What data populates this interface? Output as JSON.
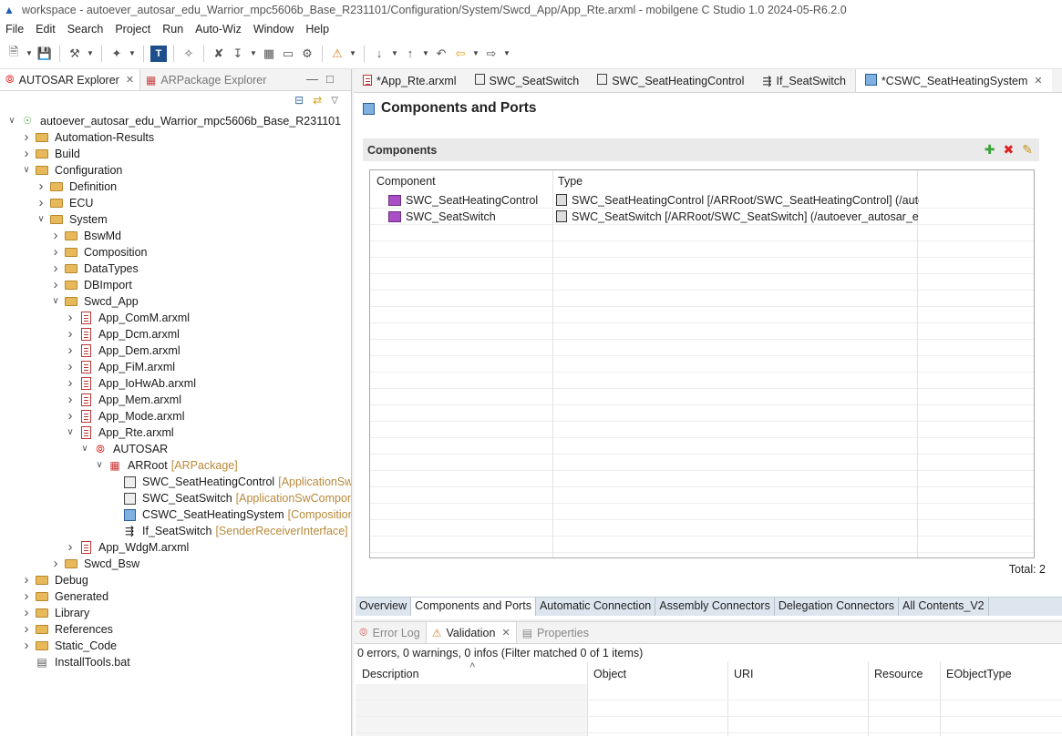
{
  "window": {
    "title": "workspace - autoever_autosar_edu_Warrior_mpc5606b_Base_R231101/Configuration/System/Swcd_App/App_Rte.arxml - mobilgene C Studio 1.0 2024-05-R6.2.0"
  },
  "menu": [
    "File",
    "Edit",
    "Search",
    "Project",
    "Run",
    "Auto-Wiz",
    "Window",
    "Help"
  ],
  "left_tabs": {
    "explorer": "AUTOSAR Explorer",
    "package_explorer": "ARPackage Explorer"
  },
  "tree": [
    {
      "label": "autoever_autosar_edu_Warrior_mpc5606b_Base_R231101",
      "type": "",
      "icon": "project-icon",
      "indent": 0,
      "arrow": "down"
    },
    {
      "label": "Automation-Results",
      "type": "",
      "icon": "folder-icon",
      "indent": 1,
      "arrow": "right"
    },
    {
      "label": "Build",
      "type": "",
      "icon": "folder-icon",
      "indent": 1,
      "arrow": "right"
    },
    {
      "label": "Configuration",
      "type": "",
      "icon": "folder-icon",
      "indent": 1,
      "arrow": "down"
    },
    {
      "label": "Definition",
      "type": "",
      "icon": "folder-icon",
      "indent": 2,
      "arrow": "right"
    },
    {
      "label": "ECU",
      "type": "",
      "icon": "folder-icon",
      "indent": 2,
      "arrow": "right"
    },
    {
      "label": "System",
      "type": "",
      "icon": "folder-icon",
      "indent": 2,
      "arrow": "down"
    },
    {
      "label": "BswMd",
      "type": "",
      "icon": "folder-icon",
      "indent": 3,
      "arrow": "right"
    },
    {
      "label": "Composition",
      "type": "",
      "icon": "folder-icon",
      "indent": 3,
      "arrow": "right"
    },
    {
      "label": "DataTypes",
      "type": "",
      "icon": "folder-icon",
      "indent": 3,
      "arrow": "right"
    },
    {
      "label": "DBImport",
      "type": "",
      "icon": "folder-icon",
      "indent": 3,
      "arrow": "right"
    },
    {
      "label": "Swcd_App",
      "type": "",
      "icon": "folder-icon",
      "indent": 3,
      "arrow": "down"
    },
    {
      "label": "App_ComM.arxml",
      "type": "",
      "icon": "arxml-file-icon",
      "indent": 4,
      "arrow": "right"
    },
    {
      "label": "App_Dcm.arxml",
      "type": "",
      "icon": "arxml-file-icon",
      "indent": 4,
      "arrow": "right"
    },
    {
      "label": "App_Dem.arxml",
      "type": "",
      "icon": "arxml-file-icon",
      "indent": 4,
      "arrow": "right"
    },
    {
      "label": "App_FiM.arxml",
      "type": "",
      "icon": "arxml-file-icon",
      "indent": 4,
      "arrow": "right"
    },
    {
      "label": "App_IoHwAb.arxml",
      "type": "",
      "icon": "arxml-file-icon",
      "indent": 4,
      "arrow": "right"
    },
    {
      "label": "App_Mem.arxml",
      "type": "",
      "icon": "arxml-file-icon",
      "indent": 4,
      "arrow": "right"
    },
    {
      "label": "App_Mode.arxml",
      "type": "",
      "icon": "arxml-file-icon",
      "indent": 4,
      "arrow": "right"
    },
    {
      "label": "App_Rte.arxml",
      "type": "",
      "icon": "arxml-file-icon",
      "indent": 4,
      "arrow": "down"
    },
    {
      "label": "AUTOSAR",
      "type": "",
      "icon": "autosar-icon",
      "indent": 5,
      "arrow": "down"
    },
    {
      "label": "ARRoot",
      "type": "[ARPackage]",
      "icon": "package-icon",
      "indent": 6,
      "arrow": "down"
    },
    {
      "label": "SWC_SeatHeatingControl",
      "type": "[ApplicationSwComponentType]",
      "icon": "swc-icon",
      "indent": 7,
      "arrow": ""
    },
    {
      "label": "SWC_SeatSwitch",
      "type": "[ApplicationSwComponentType]",
      "icon": "swc-icon",
      "indent": 7,
      "arrow": ""
    },
    {
      "label": "CSWC_SeatHeatingSystem",
      "type": "[CompositionSwComponentType]",
      "icon": "composition-icon",
      "indent": 7,
      "arrow": ""
    },
    {
      "label": "If_SeatSwitch",
      "type": "[SenderReceiverInterface]",
      "icon": "interface-icon",
      "indent": 7,
      "arrow": ""
    },
    {
      "label": "App_WdgM.arxml",
      "type": "",
      "icon": "arxml-file-icon",
      "indent": 4,
      "arrow": "right"
    },
    {
      "label": "Swcd_Bsw",
      "type": "",
      "icon": "folder-icon",
      "indent": 3,
      "arrow": "right"
    },
    {
      "label": "Debug",
      "type": "",
      "icon": "folder-icon",
      "indent": 1,
      "arrow": "right"
    },
    {
      "label": "Generated",
      "type": "",
      "icon": "folder-icon",
      "indent": 1,
      "arrow": "right"
    },
    {
      "label": "Library",
      "type": "",
      "icon": "folder-icon",
      "indent": 1,
      "arrow": "right"
    },
    {
      "label": "References",
      "type": "",
      "icon": "folder-icon",
      "indent": 1,
      "arrow": "right"
    },
    {
      "label": "Static_Code",
      "type": "",
      "icon": "folder-icon",
      "indent": 1,
      "arrow": "right"
    },
    {
      "label": "InstallTools.bat",
      "type": "",
      "icon": "bat-file-icon",
      "indent": 1,
      "arrow": ""
    }
  ],
  "editor_tabs": [
    {
      "label": "*App_Rte.arxml",
      "icon": "arxml-file-icon",
      "active": false
    },
    {
      "label": "SWC_SeatSwitch",
      "icon": "swc-icon",
      "active": false
    },
    {
      "label": "SWC_SeatHeatingControl",
      "icon": "swc-icon",
      "active": false
    },
    {
      "label": "If_SeatSwitch",
      "icon": "interface-icon",
      "active": false
    },
    {
      "label": "*CSWC_SeatHeatingSystem",
      "icon": "composition-icon",
      "active": true
    }
  ],
  "editor": {
    "title": "Components and Ports",
    "section": "Components",
    "columns": {
      "component": "Component",
      "type": "Type"
    },
    "rows": [
      {
        "component": "SWC_SeatHeatingControl",
        "type": "SWC_SeatHeatingControl [/ARRoot/SWC_SeatHeatingControl] (/autoever_autosar_edu_Warrior_mpc5606b_Base_R231101/Configuration/System/Swcd_App/App_Rte.arxml)"
      },
      {
        "component": "SWC_SeatSwitch",
        "type": "SWC_SeatSwitch [/ARRoot/SWC_SeatSwitch] (/autoever_autosar_edu_Warrior_mpc5606b_Base_R231101/Configuration/System/Swcd_App/App_Rte.arxml)"
      }
    ],
    "total": "Total: 2"
  },
  "page_tabs": [
    {
      "label": "Overview",
      "active": false
    },
    {
      "label": "Components and Ports",
      "active": true
    },
    {
      "label": "Automatic Connection",
      "active": false
    },
    {
      "label": "Assembly Connectors",
      "active": false
    },
    {
      "label": "Delegation Connectors",
      "active": false
    },
    {
      "label": "All Contents_V2",
      "active": false
    }
  ],
  "bottom_tabs": [
    {
      "label": "Error Log",
      "active": false
    },
    {
      "label": "Validation",
      "active": true
    },
    {
      "label": "Properties",
      "active": false
    }
  ],
  "validation": {
    "status": "0 errors, 0 warnings, 0 infos (Filter matched 0 of 1 items)",
    "columns": [
      "Description",
      "Object",
      "URI",
      "Resource",
      "EObjectType"
    ]
  },
  "colors": {
    "accent": "#1e5fb4",
    "type_text": "#b88a3a",
    "page_tabs_bg": "#dde6ef"
  }
}
